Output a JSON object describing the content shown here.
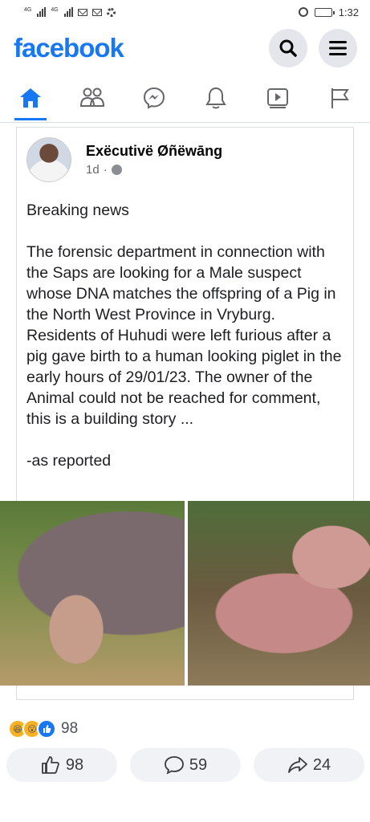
{
  "status_bar": {
    "time": "1:32",
    "signal_tag_1": "4G",
    "signal_tag_2": "4G"
  },
  "header": {
    "logo": "facebook"
  },
  "nav": {
    "tabs": [
      {
        "name": "home",
        "icon": "home-icon",
        "active": true
      },
      {
        "name": "friends",
        "icon": "friends-icon",
        "active": false
      },
      {
        "name": "messenger",
        "icon": "messenger-icon",
        "active": false
      },
      {
        "name": "notifications",
        "icon": "bell-icon",
        "active": false
      },
      {
        "name": "watch",
        "icon": "video-icon",
        "active": false
      },
      {
        "name": "pages",
        "icon": "flag-icon",
        "active": false
      }
    ]
  },
  "post": {
    "author": "Exëcutivë Øñëwāng",
    "time": "1d",
    "separator": "·",
    "paragraphs": [
      "Breaking news",
      "The forensic department in connection with the Saps are looking for a Male suspect whose DNA matches the offspring of a Pig in the North West Province in Vryburg. Residents of Huhudi were left furious after a pig gave birth to a human looking piglet in the early hours of 29/01/23. The owner of the Animal could not be reached for comment, this is a building story ...",
      "-as reported"
    ]
  },
  "reactions": {
    "count": "98"
  },
  "actions": {
    "like_count": "98",
    "comment_count": "59",
    "share_count": "24"
  },
  "colors": {
    "brand": "#1877f2",
    "button_bg": "#f0f2f5"
  }
}
